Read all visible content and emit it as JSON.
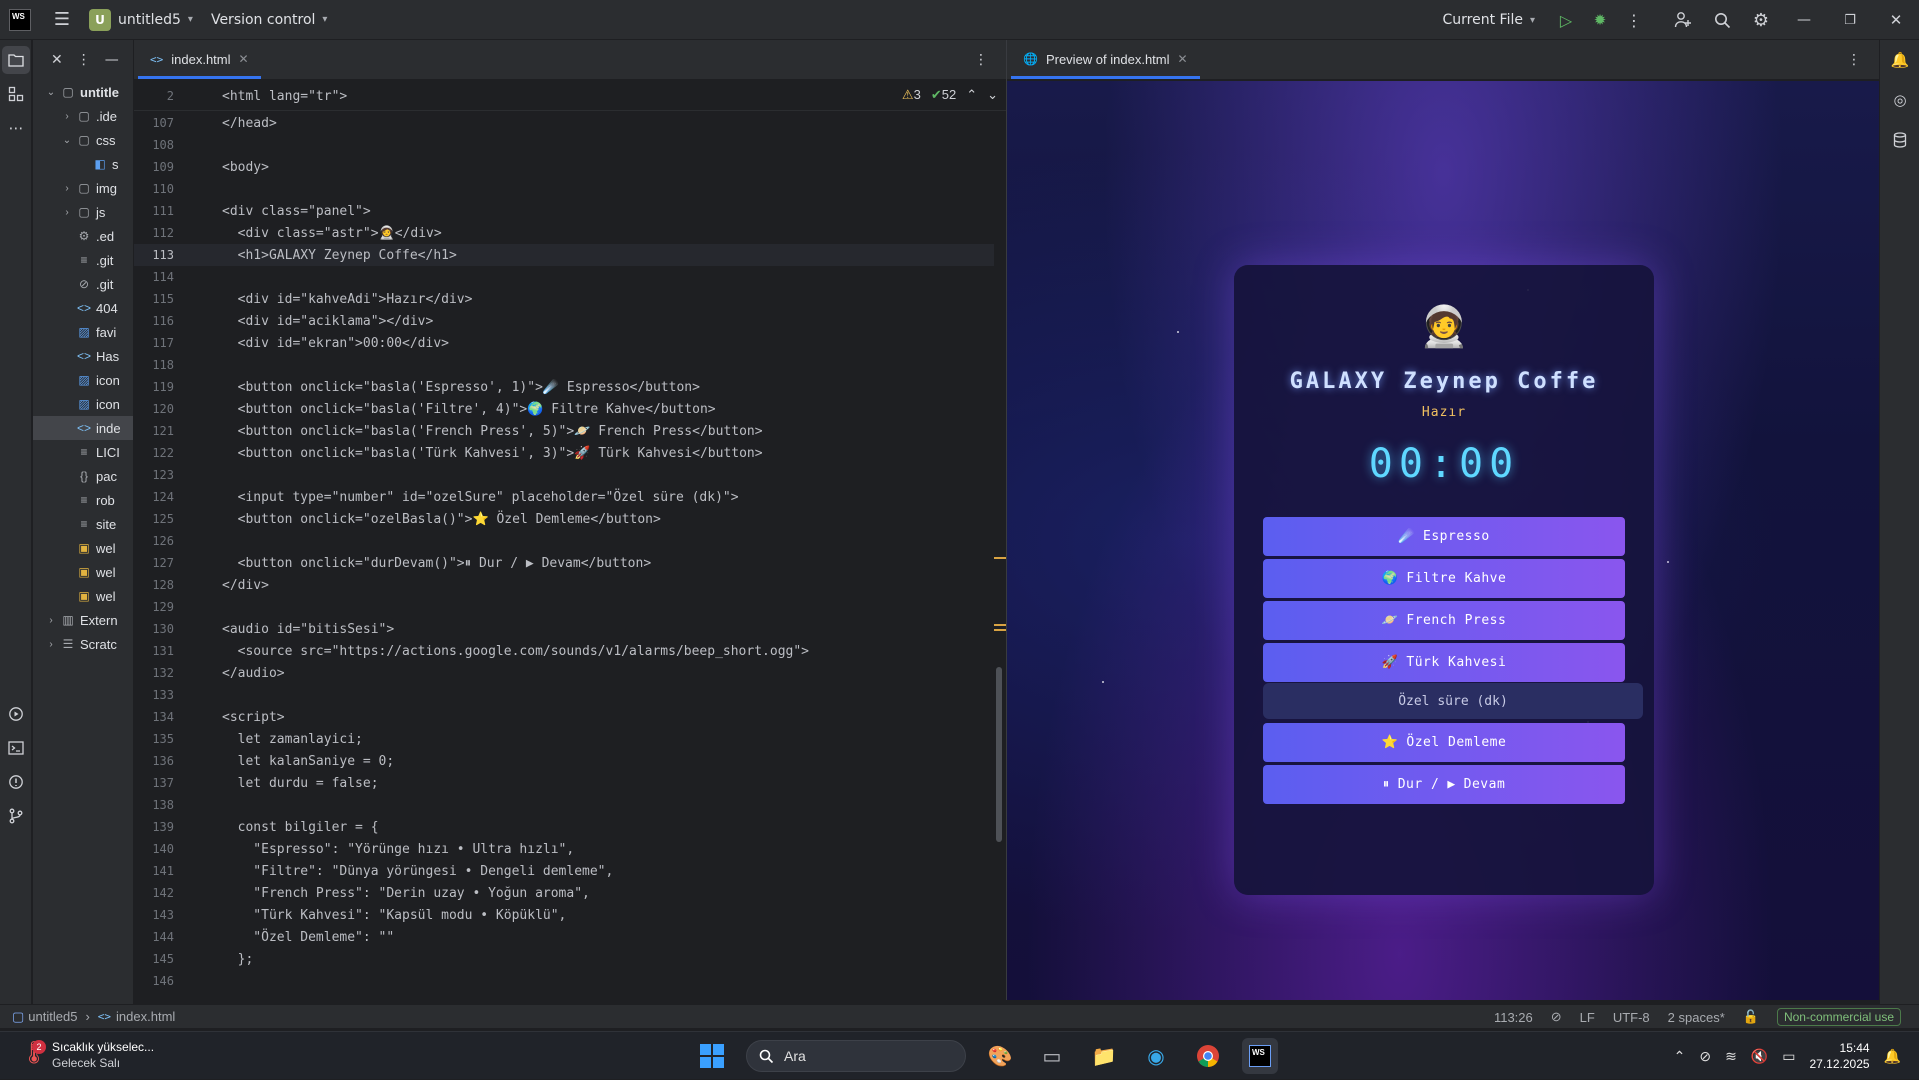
{
  "titlebar": {
    "logo": "WS",
    "project_initial": "U",
    "project_name": "untitled5",
    "vcs": "Version control",
    "run_config": "Current File"
  },
  "project_tree": [
    {
      "label": "untitle",
      "indent": 0,
      "arrow": "down",
      "icon": "folder",
      "bold": true
    },
    {
      "label": ".ide",
      "indent": 1,
      "arrow": "right",
      "icon": "folder"
    },
    {
      "label": "css",
      "indent": 1,
      "arrow": "down",
      "icon": "folder"
    },
    {
      "label": "s",
      "indent": 2,
      "arrow": "",
      "icon": "css-file"
    },
    {
      "label": "img",
      "indent": 1,
      "arrow": "right",
      "icon": "folder"
    },
    {
      "label": "js",
      "indent": 1,
      "arrow": "right",
      "icon": "folder"
    },
    {
      "label": ".ed",
      "indent": 1,
      "arrow": "",
      "icon": "gear"
    },
    {
      "label": ".git",
      "indent": 1,
      "arrow": "",
      "icon": "lines"
    },
    {
      "label": ".git",
      "indent": 1,
      "arrow": "",
      "icon": "ignore"
    },
    {
      "label": "404",
      "indent": 1,
      "arrow": "",
      "icon": "html"
    },
    {
      "label": "favi",
      "indent": 1,
      "arrow": "",
      "icon": "image"
    },
    {
      "label": "Has",
      "indent": 1,
      "arrow": "",
      "icon": "html"
    },
    {
      "label": "icon",
      "indent": 1,
      "arrow": "",
      "icon": "image"
    },
    {
      "label": "icon",
      "indent": 1,
      "arrow": "",
      "icon": "image"
    },
    {
      "label": "inde",
      "indent": 1,
      "arrow": "",
      "icon": "html",
      "selected": true
    },
    {
      "label": "LICI",
      "indent": 1,
      "arrow": "",
      "icon": "lines"
    },
    {
      "label": "pac",
      "indent": 1,
      "arrow": "",
      "icon": "json"
    },
    {
      "label": "rob",
      "indent": 1,
      "arrow": "",
      "icon": "lines"
    },
    {
      "label": "site",
      "indent": 1,
      "arrow": "",
      "icon": "lines"
    },
    {
      "label": "wel",
      "indent": 1,
      "arrow": "",
      "icon": "js"
    },
    {
      "label": "wel",
      "indent": 1,
      "arrow": "",
      "icon": "js"
    },
    {
      "label": "wel",
      "indent": 1,
      "arrow": "",
      "icon": "js"
    },
    {
      "label": "Extern",
      "indent": 0,
      "arrow": "right",
      "icon": "library"
    },
    {
      "label": "Scratc",
      "indent": 0,
      "arrow": "right",
      "icon": "scratch"
    }
  ],
  "editor": {
    "tab_label": "index.html",
    "sticky_line_no": "2",
    "sticky_code": "<html lang=\"tr\">",
    "warnings": "3",
    "checks": "52",
    "lines": [
      {
        "n": "107",
        "t": "</head>"
      },
      {
        "n": "108",
        "t": ""
      },
      {
        "n": "109",
        "t": "<body>"
      },
      {
        "n": "110",
        "t": ""
      },
      {
        "n": "111",
        "t": "<div class=\"panel\">"
      },
      {
        "n": "112",
        "t": "  <div class=\"astr\">🧑‍🚀</div>"
      },
      {
        "n": "113",
        "t": "  <h1>GALAXY Zeynep Coffe</h1>",
        "current": true
      },
      {
        "n": "114",
        "t": ""
      },
      {
        "n": "115",
        "t": "  <div id=\"kahveAdi\">Hazır</div>"
      },
      {
        "n": "116",
        "t": "  <div id=\"aciklama\"></div>"
      },
      {
        "n": "117",
        "t": "  <div id=\"ekran\">00:00</div>"
      },
      {
        "n": "118",
        "t": ""
      },
      {
        "n": "119",
        "t": "  <button onclick=\"basla('Espresso', 1)\">☄️ Espresso</button>"
      },
      {
        "n": "120",
        "t": "  <button onclick=\"basla('Filtre', 4)\">🌍 Filtre Kahve</button>"
      },
      {
        "n": "121",
        "t": "  <button onclick=\"basla('French Press', 5)\">🪐 French Press</button>"
      },
      {
        "n": "122",
        "t": "  <button onclick=\"basla('Türk Kahvesi', 3)\">🚀 Türk Kahvesi</button>"
      },
      {
        "n": "123",
        "t": ""
      },
      {
        "n": "124",
        "t": "  <input type=\"number\" id=\"ozelSure\" placeholder=\"Özel süre (dk)\">"
      },
      {
        "n": "125",
        "t": "  <button onclick=\"ozelBasla()\">⭐ Özel Demleme</button>"
      },
      {
        "n": "126",
        "t": ""
      },
      {
        "n": "127",
        "t": "  <button onclick=\"durDevam()\">⏸ Dur / ▶ Devam</button>"
      },
      {
        "n": "128",
        "t": "</div>"
      },
      {
        "n": "129",
        "t": ""
      },
      {
        "n": "130",
        "t": "<audio id=\"bitisSesi\">"
      },
      {
        "n": "131",
        "t": "  <source src=\"https://actions.google.com/sounds/v1/alarms/beep_short.ogg\">"
      },
      {
        "n": "132",
        "t": "</audio>"
      },
      {
        "n": "133",
        "t": ""
      },
      {
        "n": "134",
        "t": "<script>"
      },
      {
        "n": "135",
        "t": "  let zamanlayici;"
      },
      {
        "n": "136",
        "t": "  let kalanSaniye = 0;"
      },
      {
        "n": "137",
        "t": "  let durdu = false;"
      },
      {
        "n": "138",
        "t": ""
      },
      {
        "n": "139",
        "t": "  const bilgiler = {"
      },
      {
        "n": "140",
        "t": "    \"Espresso\": \"Yörünge hızı • Ultra hızlı\","
      },
      {
        "n": "141",
        "t": "    \"Filtre\": \"Dünya yörüngesi • Dengeli demleme\","
      },
      {
        "n": "142",
        "t": "    \"French Press\": \"Derin uzay • Yoğun aroma\","
      },
      {
        "n": "143",
        "t": "    \"Türk Kahvesi\": \"Kapsül modu • Köpüklü\","
      },
      {
        "n": "144",
        "t": "    \"Özel Demleme\": \"\""
      },
      {
        "n": "145",
        "t": "  };"
      },
      {
        "n": "146",
        "t": ""
      }
    ]
  },
  "preview": {
    "tab_label": "Preview of index.html",
    "astronaut": "🧑‍🚀",
    "title": "GALAXY Zeynep Coffe",
    "status": "Hazır",
    "timer": "00:00",
    "buttons": [
      {
        "icon": "☄️",
        "label": "Espresso"
      },
      {
        "icon": "🌍",
        "label": "Filtre Kahve"
      },
      {
        "icon": "🪐",
        "label": "French Press"
      },
      {
        "icon": "🚀",
        "label": "Türk Kahvesi"
      }
    ],
    "input_placeholder": "Özel süre (dk)",
    "custom_button": {
      "icon": "⭐",
      "label": "Özel Demleme"
    },
    "pause_button": {
      "pause_icon": "⏸",
      "pause_label": "Dur /",
      "play_icon": "▶",
      "play_label": "Devam"
    }
  },
  "statusbar": {
    "breadcrumb_project": "untitled5",
    "breadcrumb_file": "index.html",
    "position": "113:26",
    "line_ending": "LF",
    "encoding": "UTF-8",
    "indent": "2 spaces*",
    "license": "Non-commercial use"
  },
  "taskbar": {
    "weather_title": "Sıcaklık yükselec...",
    "weather_sub": "Gelecek Salı",
    "weather_badge": "2",
    "search_label": "Ara",
    "time": "15:44",
    "date": "27.12.2025"
  },
  "colors": {
    "accent": "#3574f0",
    "warning": "#f2c55c",
    "ok": "#5fb865",
    "app_button_start": "#5b5ef0",
    "app_button_end": "#8a56ee",
    "timer": "#5fd8ff"
  }
}
